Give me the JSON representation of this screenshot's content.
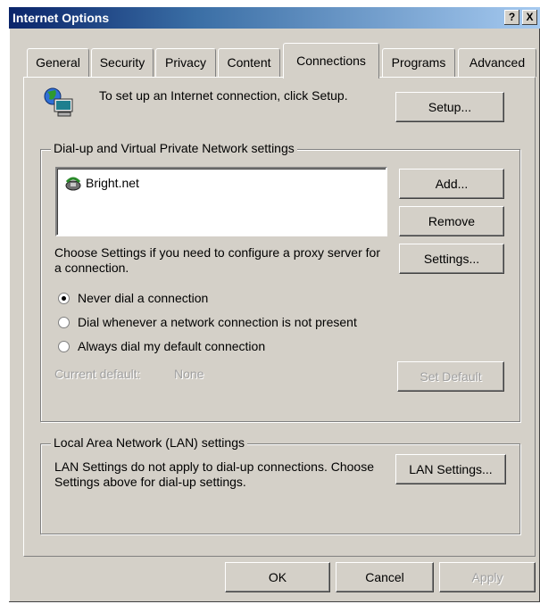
{
  "window": {
    "title": "Internet Options",
    "help_button": "?",
    "close_button": "X"
  },
  "tabs": [
    {
      "label": "General"
    },
    {
      "label": "Security"
    },
    {
      "label": "Privacy"
    },
    {
      "label": "Content"
    },
    {
      "label": "Connections",
      "active": true
    },
    {
      "label": "Programs"
    },
    {
      "label": "Advanced"
    }
  ],
  "setup": {
    "text": "To set up an Internet connection, click Setup.",
    "button": "Setup..."
  },
  "dialup": {
    "group_label": "Dial-up and Virtual Private Network settings",
    "connections": [
      {
        "name": "Bright.net"
      }
    ],
    "add_button": "Add...",
    "remove_button": "Remove",
    "proxy_text": "Choose Settings if you need to configure a proxy server for a connection.",
    "settings_button": "Settings...",
    "options": [
      {
        "label": "Never dial a connection",
        "checked": true
      },
      {
        "label": "Dial whenever a network connection is not present",
        "checked": false
      },
      {
        "label": "Always dial my default connection",
        "checked": false
      }
    ],
    "current_default_label": "Current default:",
    "current_default_value": "None",
    "set_default_button": "Set Default"
  },
  "lan": {
    "group_label": "Local Area Network (LAN) settings",
    "text": "LAN Settings do not apply to dial-up connections. Choose Settings above for dial-up settings.",
    "button": "LAN Settings..."
  },
  "footer": {
    "ok": "OK",
    "cancel": "Cancel",
    "apply": "Apply"
  }
}
